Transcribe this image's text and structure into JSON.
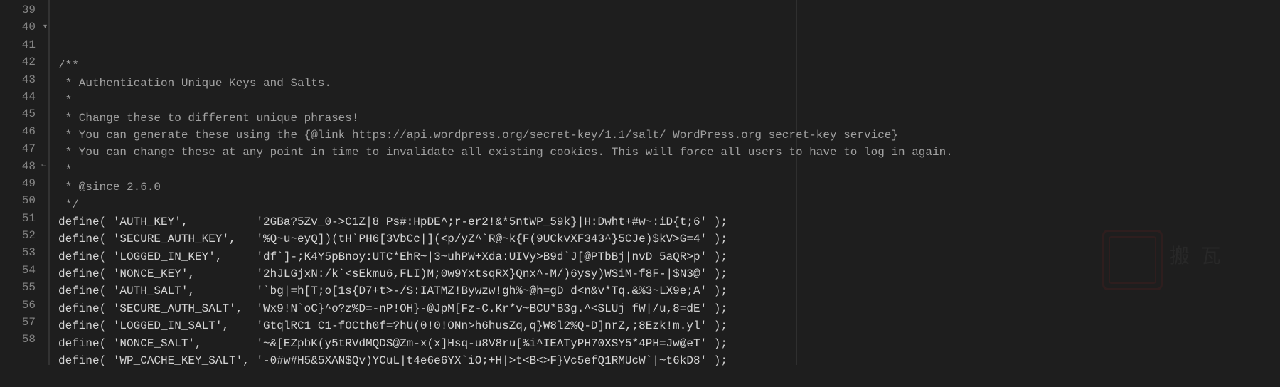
{
  "editor": {
    "startLine": 39,
    "endLine": 58,
    "foldMarkers": {
      "40": "down",
      "48": "end"
    },
    "lines": [
      {
        "n": 39,
        "text": ""
      },
      {
        "n": 40,
        "text": "/**"
      },
      {
        "n": 41,
        "text": " * Authentication Unique Keys and Salts."
      },
      {
        "n": 42,
        "text": " *"
      },
      {
        "n": 43,
        "text": " * Change these to different unique phrases!"
      },
      {
        "n": 44,
        "text": " * You can generate these using the {@link https://api.wordpress.org/secret-key/1.1/salt/ WordPress.org secret-key service}"
      },
      {
        "n": 45,
        "text": " * You can change these at any point in time to invalidate all existing cookies. This will force all users to have to log in again."
      },
      {
        "n": 46,
        "text": " *"
      },
      {
        "n": 47,
        "text": " * @since 2.6.0"
      },
      {
        "n": 48,
        "text": " */"
      },
      {
        "n": 49,
        "text": "define( 'AUTH_KEY',          '2GBa?5Zv_0->C1Z|8 Ps#:HpDE^;r-er2!&*5ntWP_59k}|H:Dwht+#w~:iD{t;6' );"
      },
      {
        "n": 50,
        "text": "define( 'SECURE_AUTH_KEY',   '%Q~u~eyQ])(tH`PH6[3VbCc|](<p/yZ^`R@~k{F(9UCkvXF343^}5CJe)$kV>G=4' );"
      },
      {
        "n": 51,
        "text": "define( 'LOGGED_IN_KEY',     'df`]-;K4Y5pBnoy:UTC*EhR~|3~uhPW+Xda:UIVy>B9d`J[@PTbBj|nvD 5aQR>p' );"
      },
      {
        "n": 52,
        "text": "define( 'NONCE_KEY',         '2hJLGjxN:/k`<sEkmu6,FLI)M;0w9YxtsqRX}Qnx^-M/)6ysy)WSiM-f8F-|$N3@' );"
      },
      {
        "n": 53,
        "text": "define( 'AUTH_SALT',         '`bg|=h[T;o[1s{D7+t>-/S:IATMZ!Bywzw!gh%~@h=gD d<n&v*Tq.&%3~LX9e;A' );"
      },
      {
        "n": 54,
        "text": "define( 'SECURE_AUTH_SALT',  'Wx9!N`oC}^o?z%D=-nP!OH}-@JpM[Fz-C.Kr*v~BCU*B3g.^<SLUj fW|/u,8=dE' );"
      },
      {
        "n": 55,
        "text": "define( 'LOGGED_IN_SALT',    'GtqlRC1 C1-fOCth0f=?hU(0!0!ONn>h6husZq,q}W8l2%Q-D]nrZ,;8Ezk!m.yl' );"
      },
      {
        "n": 56,
        "text": "define( 'NONCE_SALT',        '~&[EZpbK(y5tRVdMQDS@Zm-x(x]Hsq-u8V8ru[%i^IEATyPH70XSY5*4PH=Jw@eT' );"
      },
      {
        "n": 57,
        "text": "define( 'WP_CACHE_KEY_SALT', '-0#w#H5&5XAN$Qv)YCuL|t4e6e6YX`iO;+H|>t<B<>F}Vc5efQ1RMUcW`|~t6kD8' );"
      },
      {
        "n": 58,
        "text": ""
      }
    ]
  },
  "watermark": {
    "text": "搬  瓦"
  }
}
